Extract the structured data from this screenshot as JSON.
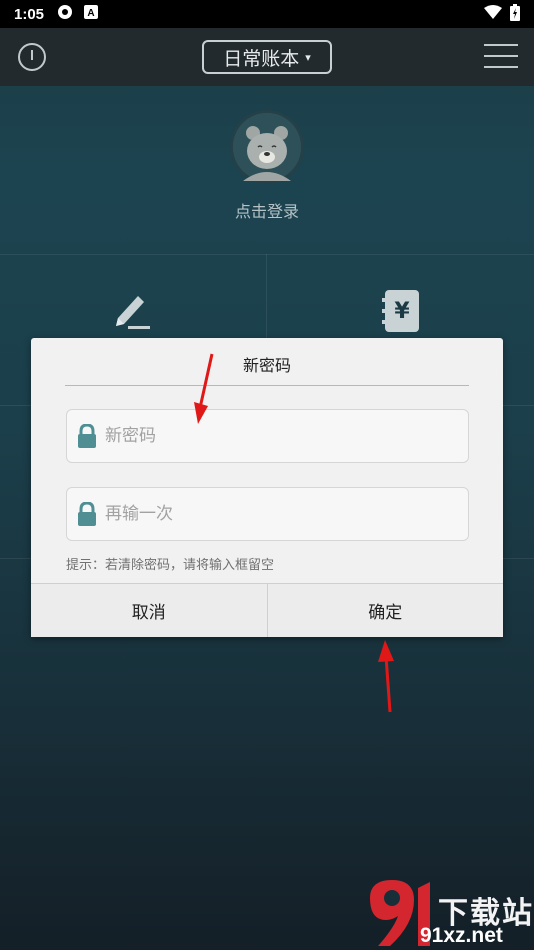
{
  "status_bar": {
    "time": "1:05",
    "icons": [
      "settings-app-icon",
      "a-app-icon",
      "wifi-icon",
      "battery-icon"
    ]
  },
  "toolbar": {
    "book_label": "日常账本",
    "caret": "▾"
  },
  "profile": {
    "login_label": "点击登录"
  },
  "dialog": {
    "title": "新密码",
    "new_password_placeholder": "新密码",
    "confirm_placeholder": "再输一次",
    "hint": "提示：若清除密码，请将输入框留空",
    "cancel_label": "取消",
    "confirm_label": "确定"
  },
  "watermark": {
    "text": "下载站",
    "url": "91xz.net"
  },
  "colors": {
    "background_top": "#1c4450",
    "toolbar": "#222a2e",
    "arrow": "#e01818",
    "lock": "#4f8f94"
  }
}
